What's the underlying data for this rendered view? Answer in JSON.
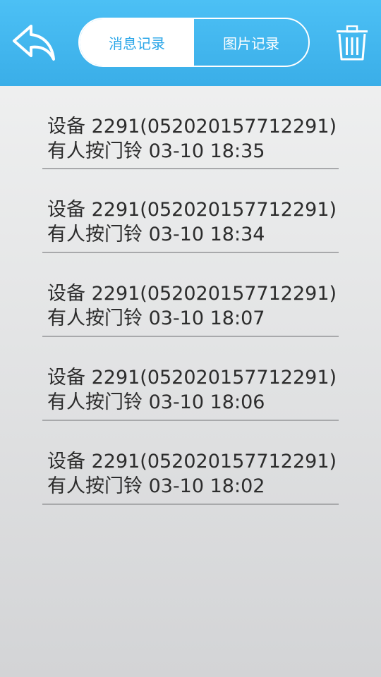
{
  "header": {
    "back_icon": "back-arrow-icon",
    "tabs": [
      {
        "label": "消息记录",
        "active": true
      },
      {
        "label": "图片记录",
        "active": false
      }
    ],
    "delete_icon": "trash-icon"
  },
  "records": [
    {
      "device": "设备 2291(052020157712291)",
      "event": "有人按门铃 03-10 18:35"
    },
    {
      "device": "设备 2291(052020157712291)",
      "event": "有人按门铃 03-10 18:34"
    },
    {
      "device": "设备 2291(052020157712291)",
      "event": "有人按门铃 03-10 18:07"
    },
    {
      "device": "设备 2291(052020157712291)",
      "event": "有人按门铃 03-10 18:06"
    },
    {
      "device": "设备 2291(052020157712291)",
      "event": "有人按门铃 03-10 18:02"
    }
  ]
}
